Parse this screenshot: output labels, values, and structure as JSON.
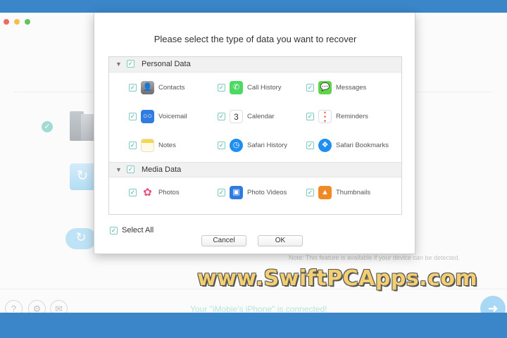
{
  "dialog": {
    "title": "Please select the type of data you want to recover",
    "sections": [
      {
        "label": "Personal Data",
        "checked": true,
        "items": [
          {
            "label": "Contacts",
            "icon": "contacts-icon",
            "checked": true
          },
          {
            "label": "Call History",
            "icon": "phone-icon",
            "checked": true
          },
          {
            "label": "Messages",
            "icon": "messages-icon",
            "checked": true
          },
          {
            "label": "Voicemail",
            "icon": "voicemail-icon",
            "checked": true
          },
          {
            "label": "Calendar",
            "icon": "calendar-icon",
            "checked": true
          },
          {
            "label": "Reminders",
            "icon": "reminders-icon",
            "checked": true
          },
          {
            "label": "Notes",
            "icon": "notes-icon",
            "checked": true
          },
          {
            "label": "Safari History",
            "icon": "safari-icon",
            "checked": true
          },
          {
            "label": "Safari Bookmarks",
            "icon": "bookmarks-icon",
            "checked": true
          }
        ]
      },
      {
        "label": "Media Data",
        "checked": true,
        "items": [
          {
            "label": "Photos",
            "icon": "photos-icon",
            "checked": true
          },
          {
            "label": "Photo Videos",
            "icon": "photo-videos-icon",
            "checked": true
          },
          {
            "label": "Thumbnails",
            "icon": "thumbnails-icon",
            "checked": true
          }
        ]
      }
    ],
    "calendar_day": "3",
    "select_all_label": "Select All",
    "cancel_label": "Cancel",
    "ok_label": "OK"
  },
  "main": {
    "note": "Note: This feature is available if your device can be detected.",
    "status": "Your \"iMobie's iPhone\" is connected!"
  },
  "watermark": "www.SwiftPCApps.com",
  "colors": {
    "accent": "#3fb2a7",
    "frame_blue": "#3a86c8"
  }
}
